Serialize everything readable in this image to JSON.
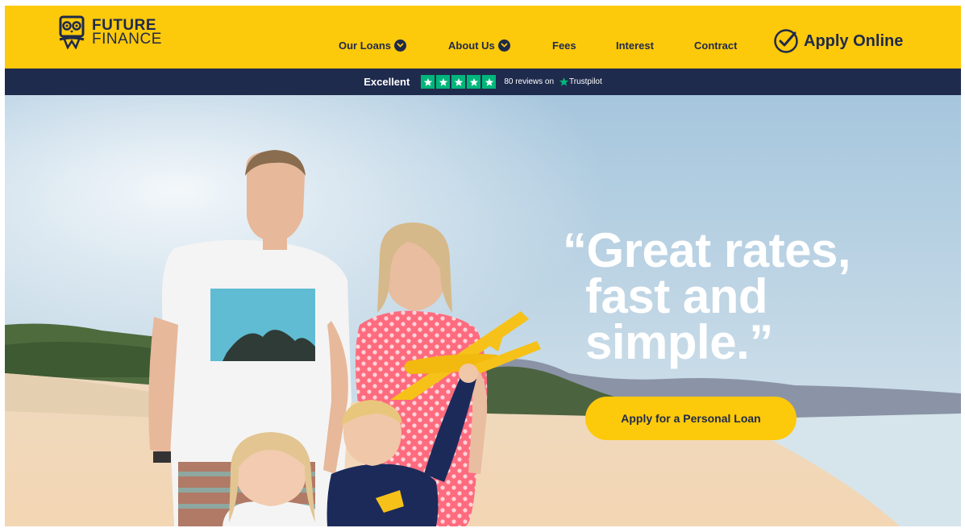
{
  "brand": {
    "line1": "FUTURE",
    "line2": "FINANCE",
    "logo_icon": "owl-icon"
  },
  "nav": {
    "items": [
      {
        "label": "Our Loans",
        "has_dropdown": true
      },
      {
        "label": "About Us",
        "has_dropdown": true
      },
      {
        "label": "Fees",
        "has_dropdown": false
      },
      {
        "label": "Interest",
        "has_dropdown": false
      },
      {
        "label": "Contract",
        "has_dropdown": false
      }
    ],
    "apply_online": "Apply Online"
  },
  "trustbar": {
    "rating_word": "Excellent",
    "stars": 5,
    "reviews": "80 reviews on",
    "brand": "Trustpilot"
  },
  "hero": {
    "quote_line1": "“Great rates,",
    "quote_line2": "fast and",
    "quote_line3": "simple.”",
    "cta_label": "Apply for a Personal Loan"
  },
  "colors": {
    "brand_yellow": "#fdc90b",
    "navy": "#1f2b4d",
    "trustpilot_green": "#00b67a"
  }
}
